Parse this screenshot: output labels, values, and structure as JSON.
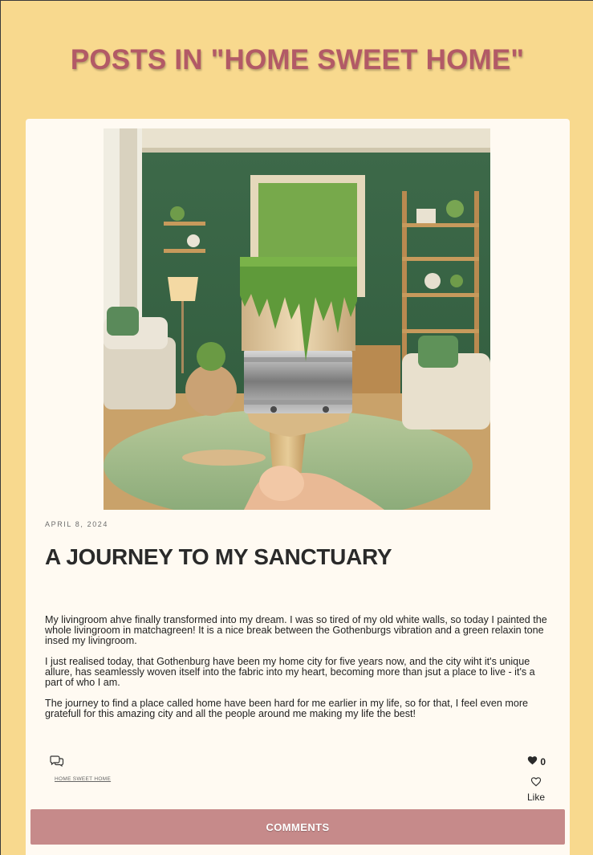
{
  "page": {
    "title": "POSTS IN \"HOME SWEET HOME\""
  },
  "post": {
    "image_alt": "paint-brush-with-green-paint-in-living-room",
    "date": "APRIL 8, 2024",
    "title": "A JOURNEY TO MY SANCTUARY",
    "paragraphs": [
      "My livingroom ahve finally transformed into my dream. I was so tired of my old white walls, so today I painted the whole livingroom in matchagreen! It is a nice break between the Gothenburgs vibration and a green relaxin tone insed my livingroom.",
      "I just realised today, that Gothenburg have been my home city for five years now, and the city wiht it's unique allure, has seamlessly woven itself into the fabric into my heart, becoming more than jsut a place to live - it's a part of who I am.",
      "The journey to find a place called home have been hard for me earlier in my life, so for that, I feel even more gratefull for this amazing city and all the people around me making my life the best!"
    ],
    "tag": "HOME SWEET HOME",
    "like_count": "0",
    "like_label": "Like"
  },
  "comments_button": "COMMENTS",
  "icons": {
    "comment": "comment-bubbles-icon",
    "heart_filled": "heart-filled-icon",
    "heart_outline": "heart-outline-icon"
  },
  "colors": {
    "background": "#f8d98e",
    "title": "#b25a66",
    "card": "#fffaf2",
    "button": "#c68a8a"
  }
}
